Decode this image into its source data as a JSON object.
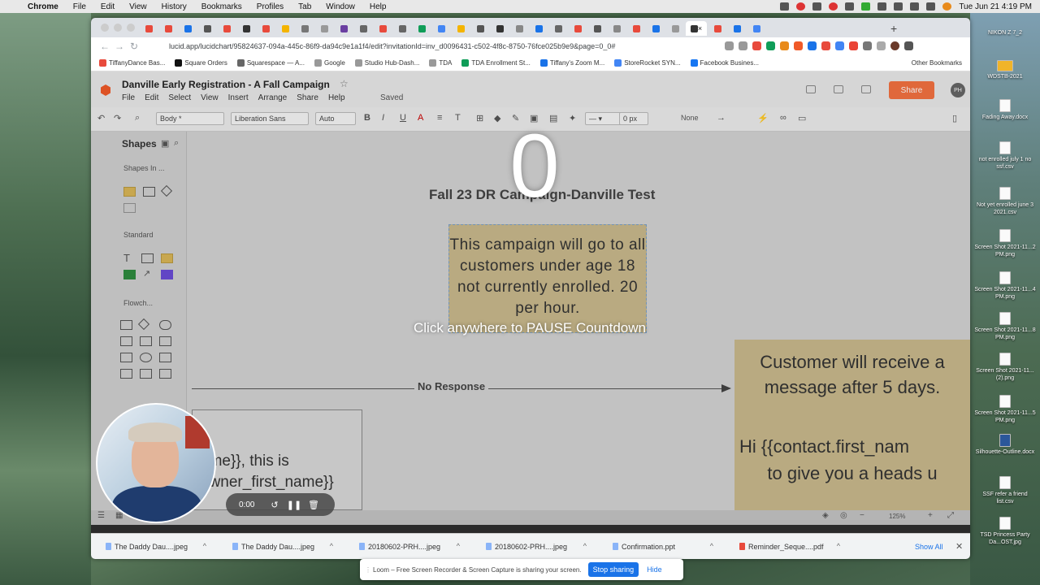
{
  "menubar": {
    "app": "Chrome",
    "items": [
      "File",
      "Edit",
      "View",
      "History",
      "Bookmarks",
      "Profiles",
      "Tab",
      "Window",
      "Help"
    ],
    "clock": "Tue Jun 21 4:19 PM"
  },
  "browser": {
    "active_tab_close": "×",
    "url": "lucid.app/lucidchart/95824637-094a-445c-86f9-da94c9e1a1f4/edit?invitationId=inv_d0096431-c502-4f8c-8750-76fce025b9e9&page=0_0#",
    "bookmarks": [
      "TiffanyDance Bas...",
      "Square Orders",
      "Squarespace — A...",
      "Google",
      "Studio Hub-Dash...",
      "TDA",
      "TDA Enrollment St...",
      "Tiffany's Zoom M...",
      "StoreRocket SYN...",
      "Facebook Busines..."
    ],
    "other_bookmarks": "Other Bookmarks"
  },
  "lucid": {
    "doc_title": "Danville Early Registration - A Fall Campaign",
    "menu": [
      "File",
      "Edit",
      "Select",
      "View",
      "Insert",
      "Arrange",
      "Share",
      "Help"
    ],
    "saved": "Saved",
    "share": "Share",
    "avatar": "PH",
    "toolbar": {
      "style": "Body *",
      "font": "Liberation Sans",
      "size": "Auto",
      "stroke": "0 px",
      "none": "None"
    },
    "panel": {
      "title": "Shapes",
      "sections": [
        "Shapes In ...",
        "Standard",
        "Flowch..."
      ]
    },
    "canvas": {
      "title": "Fall 23 DR Campaign-Danville Test",
      "note1": "This campaign will go to all customers under age 18 not currently enrolled. 20 per hour.",
      "connector_label": "No Response",
      "note2_line1": "Customer will receive a message after 5 days.",
      "note2_line2": "Hi {{contact.first_nam",
      "note2_line3": "to give you a heads u",
      "box3_line1": "ame}}, this is",
      "box3_line2": "owner_first_name}}"
    },
    "zoom": "125%"
  },
  "overlay": {
    "countdown": "0",
    "instruction": "Click anywhere to PAUSE Countdown"
  },
  "downloads": {
    "items": [
      "The Daddy Dau....jpeg",
      "The Daddy Dau....jpeg",
      "20180602-PRH....jpeg",
      "20180602-PRH....jpeg",
      "Confirmation.ppt",
      "Reminder_Seque....pdf"
    ],
    "show_all": "Show All"
  },
  "loom": {
    "timer": "0:00",
    "sharing_message": "Loom – Free Screen Recorder & Screen Capture is sharing your screen.",
    "stop": "Stop sharing",
    "hide": "Hide"
  },
  "desktop": {
    "icons": [
      "NIKON Z 7_2",
      "WDSTB-2021",
      "Fading Away.docx",
      "not enrolled july 1 no ssf.csv",
      "Not yet enrolled june 3 2021.csv",
      "Screen Shot 2021-11...2 PM.png",
      "Screen Shot 2021-11...4 PM.png",
      "Screen Shot 2021-11...8 PM.png",
      "Screen Shot 2021-11...(2).png",
      "Screen Shot 2021-11...5 PM.png",
      "Silhouette-Outline.docx",
      "SSF refer a friend list.csv",
      "TSD Princess Party Da...OST.jpg"
    ]
  }
}
